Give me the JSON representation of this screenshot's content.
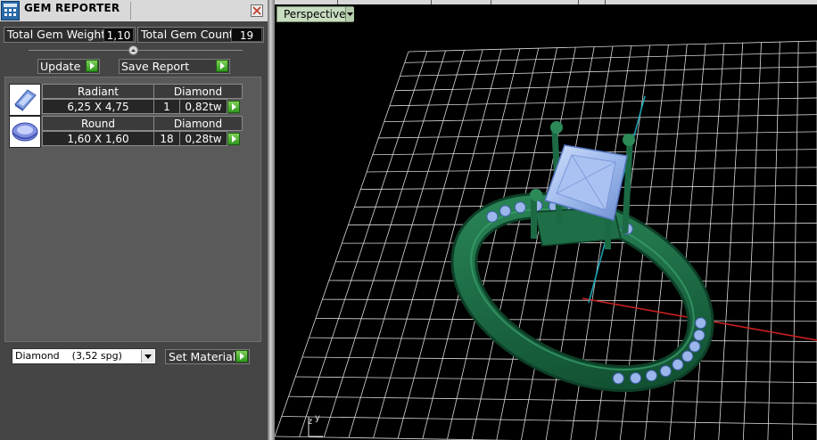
{
  "window": {
    "title": "GEM REPORTER",
    "close_icon": "close-icon",
    "app_icon": "gem-reporter-app-icon"
  },
  "summary": {
    "total_weight_label": "Total Gem Weight",
    "total_weight_value": "1,10",
    "total_count_label": "Total Gem Count",
    "total_count_value": "19"
  },
  "actions": {
    "update_label": "Update",
    "save_report_label": "Save Report"
  },
  "gems": [
    {
      "icon": "radiant-cut-gem-icon",
      "shape": "Radiant",
      "material": "Diamond",
      "size": "6,25 X 4,75",
      "count": "1",
      "weight": "0,82tw"
    },
    {
      "icon": "round-cut-gem-icon",
      "shape": "Round",
      "material": "Diamond",
      "size": "1,60 X 1,60",
      "count": "18",
      "weight": "0,28tw"
    }
  ],
  "material_select": {
    "value": "Diamond    (3,52 spg)"
  },
  "set_material_label": "Set Material",
  "viewport": {
    "view_mode": "Perspective",
    "axis_labels": {
      "y": "y",
      "z": "z"
    }
  },
  "colors": {
    "panel_bg": "#454545",
    "go_arrow": "#3fae2a",
    "ring_metal": "#1f6b45",
    "gem": "#a8c4f2",
    "grid": "#e8e8e8",
    "x_axis": "#cc1f1f",
    "z_axis": "#1aa0b0"
  }
}
